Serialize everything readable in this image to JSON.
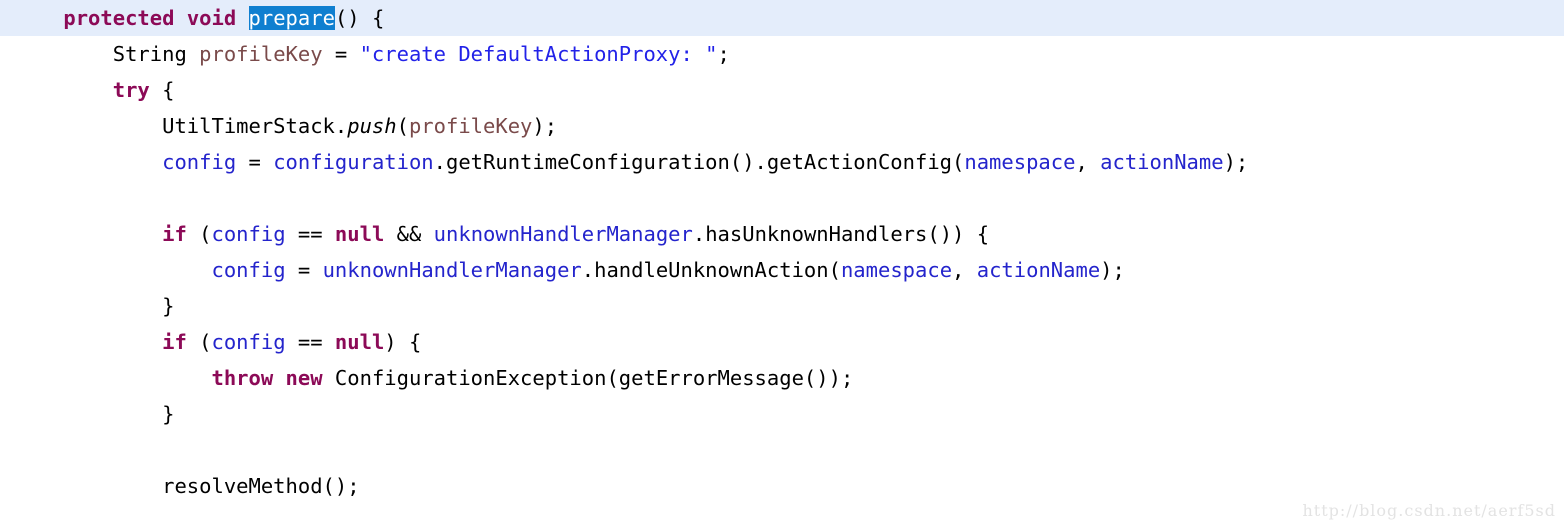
{
  "editor": {
    "language": "java",
    "font_size_px": 20.5,
    "line_height_px": 36,
    "colors": {
      "background": "#ffffff",
      "foreground": "#000000",
      "keyword": "#8c0a57",
      "string": "#2222e8",
      "field": "#2424cc",
      "local_variable": "#7a4a4a",
      "current_line_highlight": "#e4edfb",
      "selection_background": "#0f7fd0",
      "selection_foreground": "#ffffff",
      "watermark": "#e3e3e3"
    },
    "selected_text": "prepare",
    "current_line_number": 1
  },
  "lines": [
    {
      "id": "line-1",
      "current": true,
      "text": "    protected void prepare() {",
      "tokens": [
        {
          "t": "    ",
          "k": "plain"
        },
        {
          "t": "protected",
          "k": "kw"
        },
        {
          "t": " ",
          "k": "plain"
        },
        {
          "t": "void",
          "k": "kw"
        },
        {
          "t": " ",
          "k": "plain"
        },
        {
          "t": "prepare",
          "k": "sel"
        },
        {
          "t": "() {",
          "k": "plain"
        }
      ]
    },
    {
      "id": "line-2",
      "current": false,
      "text": "        String profileKey = \"create DefaultActionProxy: \";",
      "tokens": [
        {
          "t": "        String ",
          "k": "plain"
        },
        {
          "t": "profileKey",
          "k": "var"
        },
        {
          "t": " = ",
          "k": "plain"
        },
        {
          "t": "\"create DefaultActionProxy: \"",
          "k": "str"
        },
        {
          "t": ";",
          "k": "plain"
        }
      ]
    },
    {
      "id": "line-3",
      "current": false,
      "text": "        try {",
      "tokens": [
        {
          "t": "        ",
          "k": "plain"
        },
        {
          "t": "try",
          "k": "kw"
        },
        {
          "t": " {",
          "k": "plain"
        }
      ]
    },
    {
      "id": "line-4",
      "current": false,
      "text": "            UtilTimerStack.push(profileKey);",
      "tokens": [
        {
          "t": "            UtilTimerStack.",
          "k": "plain"
        },
        {
          "t": "push",
          "k": "italic"
        },
        {
          "t": "(",
          "k": "plain"
        },
        {
          "t": "profileKey",
          "k": "var"
        },
        {
          "t": ");",
          "k": "plain"
        }
      ]
    },
    {
      "id": "line-5",
      "current": false,
      "text": "            config = configuration.getRuntimeConfiguration().getActionConfig(namespace, actionName);",
      "tokens": [
        {
          "t": "            ",
          "k": "plain"
        },
        {
          "t": "config",
          "k": "field"
        },
        {
          "t": " = ",
          "k": "plain"
        },
        {
          "t": "configuration",
          "k": "field"
        },
        {
          "t": ".getRuntimeConfiguration().getActionConfig(",
          "k": "plain"
        },
        {
          "t": "namespace",
          "k": "field"
        },
        {
          "t": ", ",
          "k": "plain"
        },
        {
          "t": "actionName",
          "k": "field"
        },
        {
          "t": ");",
          "k": "plain"
        }
      ]
    },
    {
      "id": "line-6",
      "current": false,
      "text": "",
      "tokens": []
    },
    {
      "id": "line-7",
      "current": false,
      "text": "            if (config == null && unknownHandlerManager.hasUnknownHandlers()) {",
      "tokens": [
        {
          "t": "            ",
          "k": "plain"
        },
        {
          "t": "if",
          "k": "kw"
        },
        {
          "t": " (",
          "k": "plain"
        },
        {
          "t": "config",
          "k": "field"
        },
        {
          "t": " == ",
          "k": "plain"
        },
        {
          "t": "null",
          "k": "kw"
        },
        {
          "t": " && ",
          "k": "plain"
        },
        {
          "t": "unknownHandlerManager",
          "k": "field"
        },
        {
          "t": ".hasUnknownHandlers()) {",
          "k": "plain"
        }
      ]
    },
    {
      "id": "line-8",
      "current": false,
      "text": "                config = unknownHandlerManager.handleUnknownAction(namespace, actionName);",
      "tokens": [
        {
          "t": "                ",
          "k": "plain"
        },
        {
          "t": "config",
          "k": "field"
        },
        {
          "t": " = ",
          "k": "plain"
        },
        {
          "t": "unknownHandlerManager",
          "k": "field"
        },
        {
          "t": ".handleUnknownAction(",
          "k": "plain"
        },
        {
          "t": "namespace",
          "k": "field"
        },
        {
          "t": ", ",
          "k": "plain"
        },
        {
          "t": "actionName",
          "k": "field"
        },
        {
          "t": ");",
          "k": "plain"
        }
      ]
    },
    {
      "id": "line-9",
      "current": false,
      "text": "            }",
      "tokens": [
        {
          "t": "            }",
          "k": "plain"
        }
      ]
    },
    {
      "id": "line-10",
      "current": false,
      "text": "            if (config == null) {",
      "tokens": [
        {
          "t": "            ",
          "k": "plain"
        },
        {
          "t": "if",
          "k": "kw"
        },
        {
          "t": " (",
          "k": "plain"
        },
        {
          "t": "config",
          "k": "field"
        },
        {
          "t": " == ",
          "k": "plain"
        },
        {
          "t": "null",
          "k": "kw"
        },
        {
          "t": ") {",
          "k": "plain"
        }
      ]
    },
    {
      "id": "line-11",
      "current": false,
      "text": "                throw new ConfigurationException(getErrorMessage());",
      "tokens": [
        {
          "t": "                ",
          "k": "plain"
        },
        {
          "t": "throw",
          "k": "kw"
        },
        {
          "t": " ",
          "k": "plain"
        },
        {
          "t": "new",
          "k": "kw"
        },
        {
          "t": " ConfigurationException(getErrorMessage());",
          "k": "plain"
        }
      ]
    },
    {
      "id": "line-12",
      "current": false,
      "text": "            }",
      "tokens": [
        {
          "t": "            }",
          "k": "plain"
        }
      ]
    },
    {
      "id": "line-13",
      "current": false,
      "text": "",
      "tokens": []
    },
    {
      "id": "line-14",
      "current": false,
      "text": "            resolveMethod();",
      "tokens": [
        {
          "t": "            resolveMethod();",
          "k": "plain"
        }
      ]
    }
  ],
  "watermark": {
    "text": "http://blog.csdn.net/aerf5sd"
  }
}
